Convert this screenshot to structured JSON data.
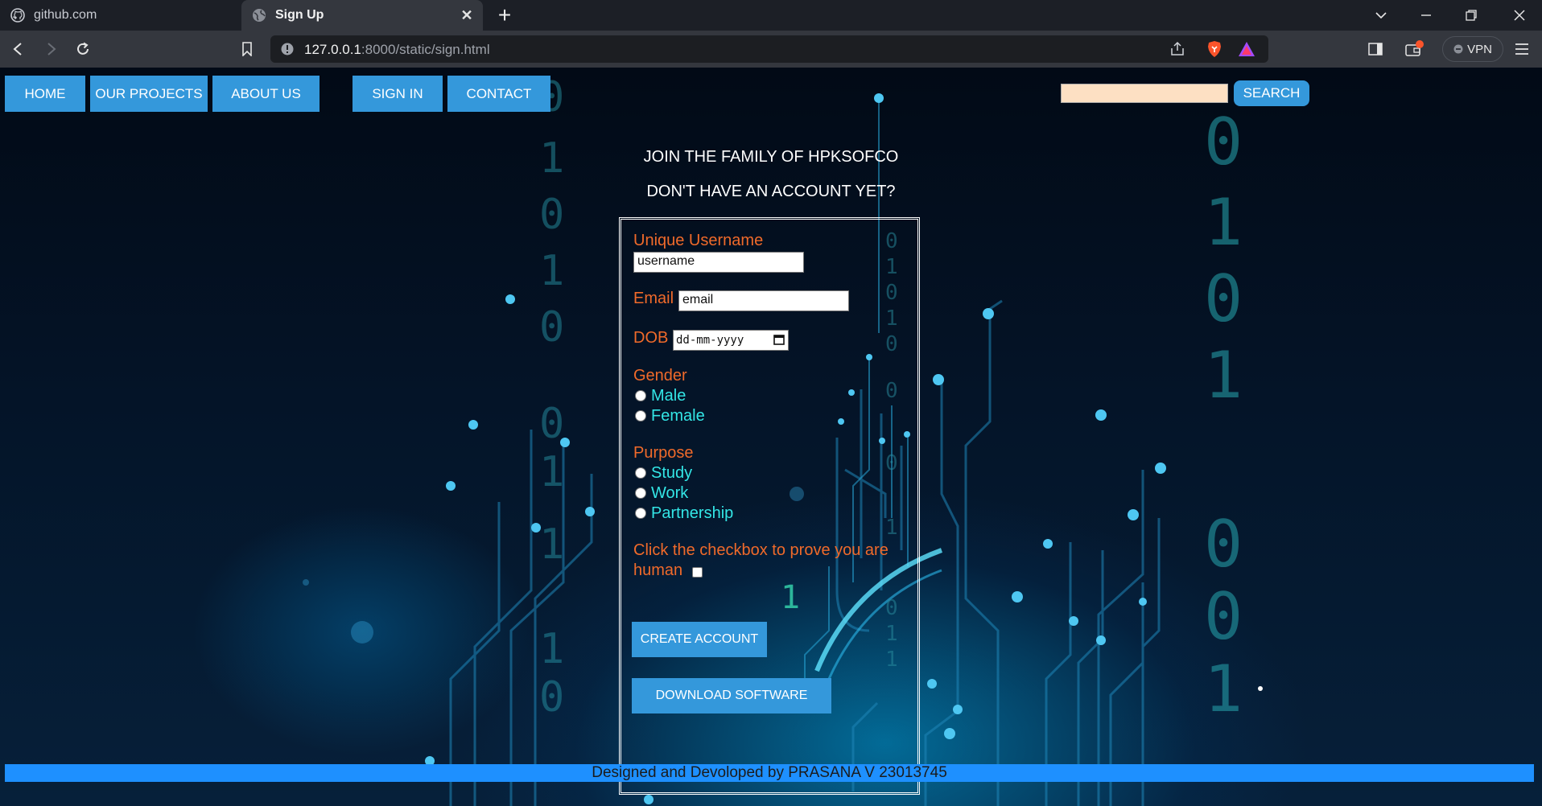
{
  "browser": {
    "tabs": [
      {
        "title": "github.com",
        "active": false,
        "icon": "github-icon"
      },
      {
        "title": "Sign Up",
        "active": true,
        "icon": "globe-icon"
      }
    ],
    "url_host": "127.0.0.1",
    "url_rest": ":8000/static/sign.html",
    "vpn_label": "VPN"
  },
  "nav": {
    "items": [
      {
        "label": "HOME"
      },
      {
        "label": "OUR PROJECTS"
      },
      {
        "label": "ABOUT US"
      },
      {
        "label": "SIGN IN"
      },
      {
        "label": "CONTACT"
      }
    ],
    "search_placeholder": "",
    "search_button": "SEARCH"
  },
  "header": {
    "line1": "JOIN THE FAMILY OF HPKSOFCO",
    "line2": "DON'T HAVE AN ACCOUNT YET?"
  },
  "form": {
    "username_label": "Unique Username",
    "username_value": "username",
    "email_label": "Email",
    "email_value": "email",
    "dob_label": "DOB",
    "dob_value": "dd-mm-yyyy",
    "gender_label": "Gender",
    "gender_options": [
      "Male",
      "Female"
    ],
    "purpose_label": "Purpose",
    "purpose_options": [
      "Study",
      "Work",
      "Partnership"
    ],
    "human_label_line1": "Click the checkbox to prove you are",
    "human_label_line2": "human",
    "create_button": "CREATE ACCOUNT",
    "download_button": "DOWNLOAD SOFTWARE"
  },
  "footer": {
    "text": "Designed and Devoloped by PRASANA V 23013745"
  },
  "colors": {
    "accent": "#3498db",
    "label": "#f06a2a",
    "option": "#33e6e6",
    "footer_bar": "#1e90ff"
  }
}
